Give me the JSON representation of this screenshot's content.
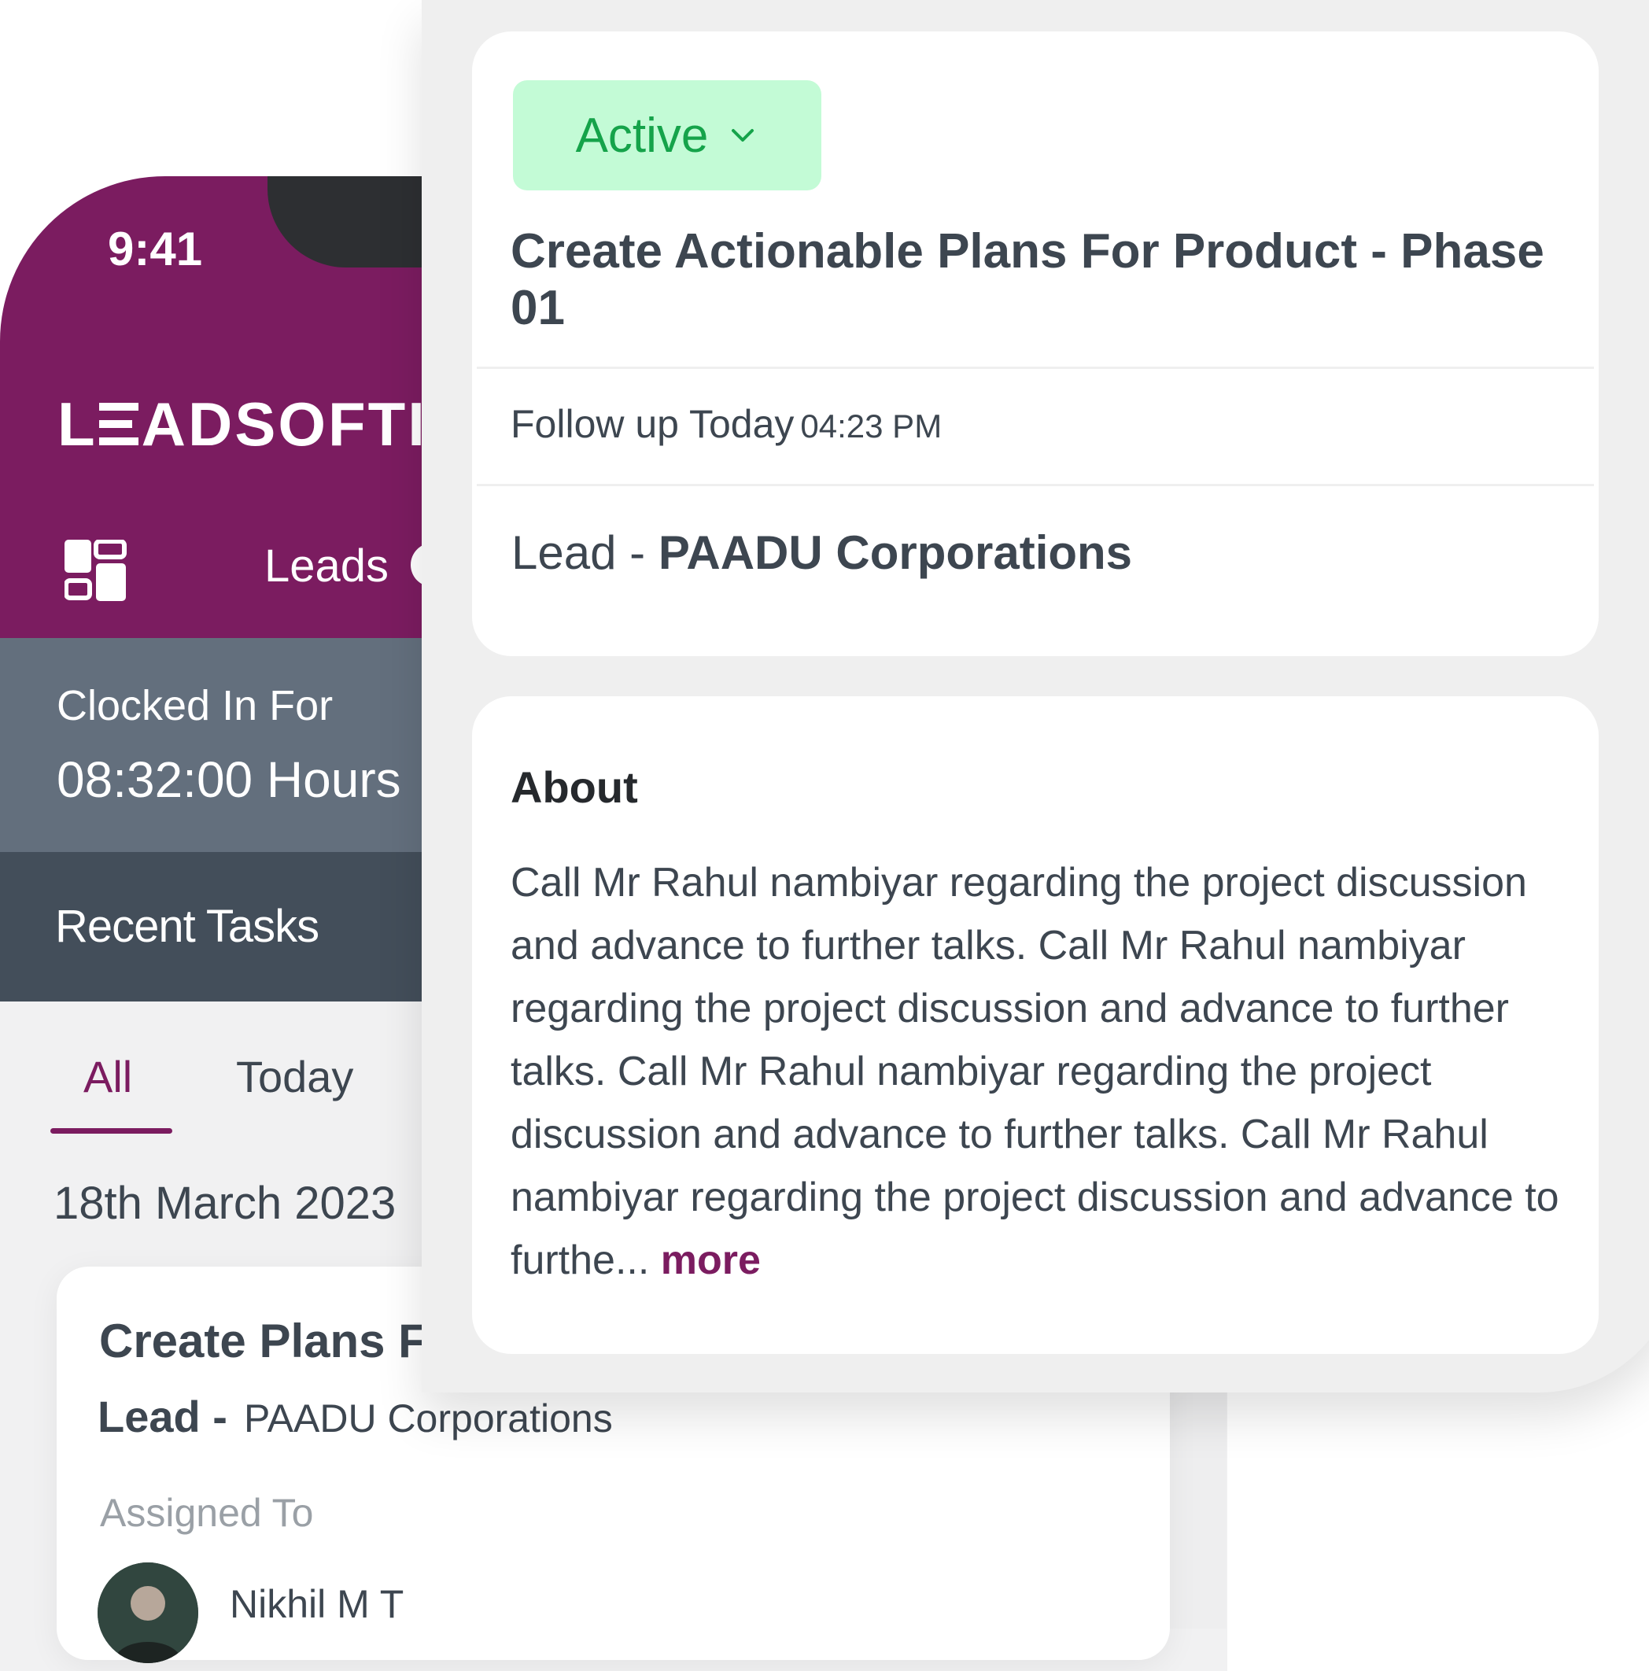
{
  "phone": {
    "status_time": "9:41",
    "logo_parts": [
      "L",
      "ADSOFTI"
    ],
    "nav_label": "Leads",
    "clock_label": "Clocked In For",
    "clock_value": "08:32:00 Hours",
    "recent_label": "Recent Tasks",
    "tabs": [
      {
        "label": "All",
        "active": true
      },
      {
        "label": "Today",
        "active": false
      }
    ],
    "date": "18th March 2023",
    "task": {
      "title": "Create Plans Fo",
      "lead_prefix": "Lead -",
      "lead_name": "PAADU Corporations",
      "assigned_label": "Assigned To",
      "assignee": "Nikhil M T"
    }
  },
  "detail": {
    "status": "Active",
    "title": "Create Actionable Plans For Product - Phase 01",
    "followup_prefix": "Follow up Today",
    "followup_time": "04:23 PM",
    "lead_prefix": "Lead -",
    "lead_name": "PAADU Corporations",
    "about_heading": "About",
    "about_text": "Call Mr Rahul nambiyar regarding the project discussion and advance to further talks. Call Mr Rahul nambiyar regarding the project discussion and advance to further talks. Call Mr Rahul nambiyar regarding the project discussion and advance to further talks. Call Mr Rahul nambiyar regarding the project discussion and advance to furthe...",
    "more_label": "more"
  },
  "colors": {
    "brand": "#7b1c60",
    "slate": "#636f7d",
    "dark_slate": "#434e5a",
    "active_bg": "#c3fbd6",
    "active_text": "#15a34a"
  }
}
